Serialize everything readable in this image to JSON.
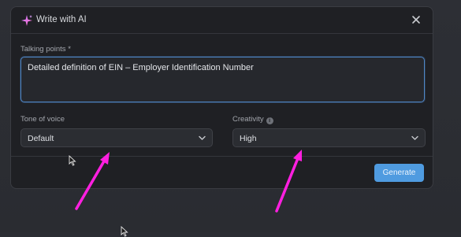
{
  "dialog": {
    "title": "Write with AI",
    "sparkle_icon": "sparkle-icon",
    "close_icon": "close-icon"
  },
  "talking_points": {
    "label": "Talking points *",
    "value": "Detailed definition of EIN – Employer Identification Number"
  },
  "tone": {
    "label": "Tone of voice",
    "value": "Default"
  },
  "creativity": {
    "label": "Creativity",
    "info_icon": "info-icon",
    "value": "High"
  },
  "generate_label": "Generate",
  "colors": {
    "accent": "#4f9be0",
    "annotation_arrow": "#ff1fe0",
    "focus_border": "#4f86c6"
  }
}
